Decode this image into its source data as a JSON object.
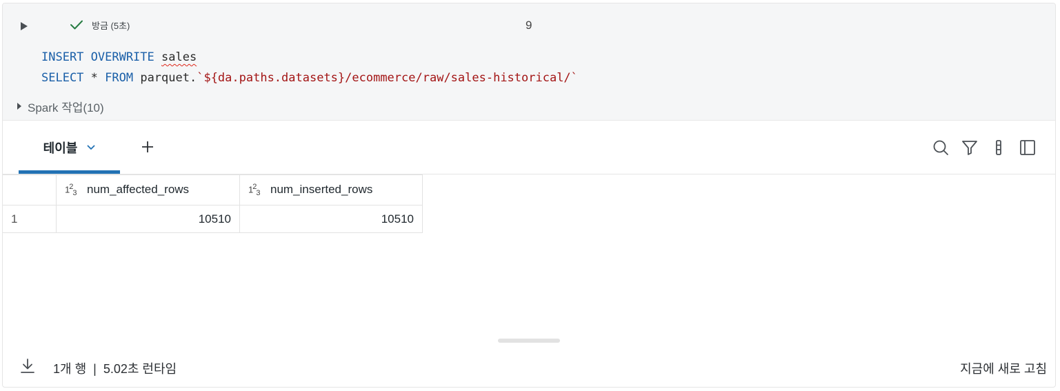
{
  "cell": {
    "status_text": "방금 (5초)",
    "line_count": "9",
    "code_lines": [
      {
        "kw1": "INSERT OVERWRITE",
        "ident": "sales"
      },
      {
        "kw1": "SELECT",
        "op": " * ",
        "kw2": "FROM",
        "plain": " parquet.",
        "str": "`${da.paths.datasets}/ecommerce/raw/sales-historical/`"
      }
    ],
    "spark_jobs_label": "Spark 작업(10)"
  },
  "tabs": [
    {
      "label": "테이블",
      "active": true
    }
  ],
  "toolbar": {
    "icons": [
      "search-icon",
      "filter-icon",
      "column-icon",
      "sidebar-panel-icon"
    ]
  },
  "table": {
    "type_icon": "1²3",
    "columns": [
      "num_affected_rows",
      "num_inserted_rows"
    ],
    "rows": [
      {
        "index": "1",
        "values": [
          "10510",
          "10510"
        ]
      }
    ]
  },
  "footer": {
    "row_count": "1개 행",
    "separator": "|",
    "runtime": "5.02초 런타임",
    "refreshed": "지금에 새로 고침"
  },
  "colors": {
    "keyword": "#1a5fa8",
    "string": "#a31515",
    "success": "#277c43",
    "tab_accent": "#2272b4"
  }
}
